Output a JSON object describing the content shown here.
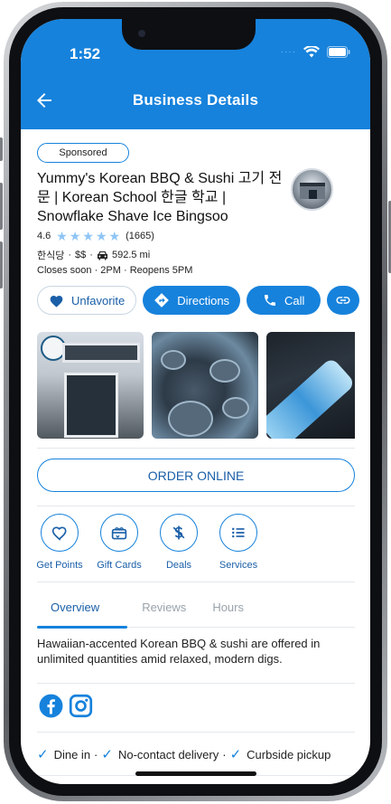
{
  "status_bar": {
    "time": "1:52"
  },
  "header": {
    "title": "Business Details"
  },
  "business": {
    "sponsored_label": "Sponsored",
    "name": "Yummy's Korean BBQ & Sushi 고기 전문 | Korean School 한글 학교 | Snowflake Shave Ice Bingsoo",
    "rating": "4.6",
    "stars": 5,
    "review_count": "(1665)",
    "category": "한식당",
    "price": "$$",
    "distance": "592.5 mi",
    "hours_status": "Closes soon · 2PM · Reopens 5PM"
  },
  "actions": {
    "favorite_label": "Unfavorite",
    "directions_label": "Directions",
    "call_label": "Call"
  },
  "order_label": "ORDER ONLINE",
  "quick_links": [
    {
      "label": "Get Points",
      "icon": "heart-icon"
    },
    {
      "label": "Gift Cards",
      "icon": "gift-card-icon"
    },
    {
      "label": "Deals",
      "icon": "dollar-tag-icon"
    },
    {
      "label": "Services",
      "icon": "list-icon"
    }
  ],
  "tabs": [
    {
      "label": "Overview"
    },
    {
      "label": "Reviews"
    },
    {
      "label": "Hours"
    }
  ],
  "overview_text": "Hawaiian-accented Korean BBQ & sushi are offered in unlimited quantities amid relaxed, modern digs.",
  "features": [
    {
      "label": "Dine in"
    },
    {
      "label": "No-contact delivery"
    },
    {
      "label": "Curbside pickup"
    }
  ],
  "colors": {
    "accent": "#1682dc",
    "star": "#8ec5f5"
  }
}
